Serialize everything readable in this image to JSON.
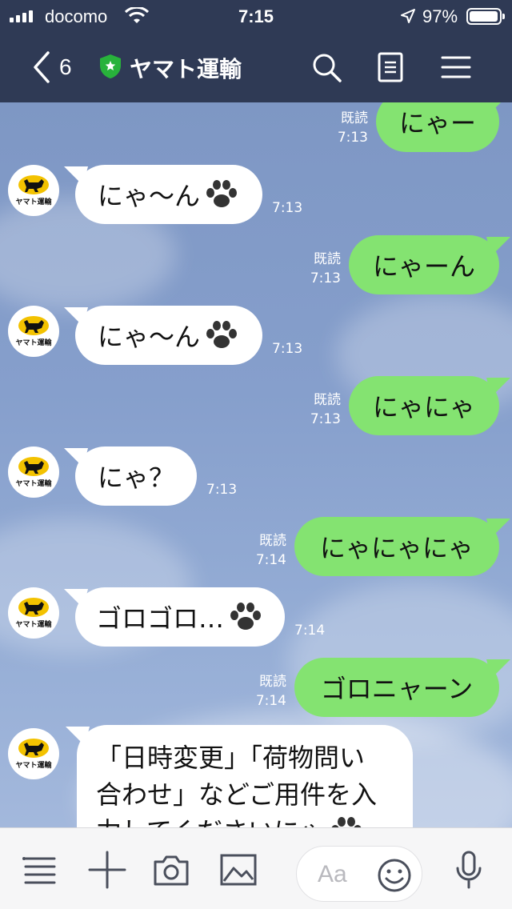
{
  "status_bar": {
    "carrier": "docomo",
    "time": "7:15",
    "battery": "97%",
    "icons": [
      "signal-icon",
      "wifi-icon",
      "location-arrow-icon",
      "battery-icon"
    ]
  },
  "header": {
    "back_count": "6",
    "title": "ヤマト運輸",
    "icons": [
      "back-chevron-icon",
      "verified-shield-icon",
      "search-icon",
      "notes-icon",
      "menu-icon"
    ]
  },
  "account": {
    "logo_text": "ヤマト運輸"
  },
  "messages": [
    {
      "dir": "out",
      "text": "にゃー",
      "read": "既読",
      "time": "7:13"
    },
    {
      "dir": "in",
      "text": "にゃ〜ん",
      "paw": true,
      "time": "7:13"
    },
    {
      "dir": "out",
      "text": "にゃーん",
      "read": "既読",
      "time": "7:13"
    },
    {
      "dir": "in",
      "text": "にゃ〜ん",
      "paw": true,
      "time": "7:13"
    },
    {
      "dir": "out",
      "text": "にゃにゃ",
      "read": "既読",
      "time": "7:13"
    },
    {
      "dir": "in",
      "text": "にゃ？",
      "paw": false,
      "time": "7:13"
    },
    {
      "dir": "out",
      "text": "にゃにゃにゃ",
      "read": "既読",
      "time": "7:14"
    },
    {
      "dir": "in",
      "text": "ゴロゴロ…",
      "paw": true,
      "time": "7:14"
    },
    {
      "dir": "out",
      "text": "ゴロニャーン",
      "read": "既読",
      "time": "7:14"
    },
    {
      "dir": "in",
      "lines": [
        "「日時変更」「荷物問い",
        "合わせ」などご用件を入",
        "力してくださいにゃ"
      ],
      "paw": true
    }
  ],
  "input_bar": {
    "placeholder": "Aa",
    "icons": [
      "menu-list-icon",
      "plus-icon",
      "camera-icon",
      "image-icon",
      "emoji-icon",
      "microphone-icon"
    ]
  },
  "colors": {
    "header": "#2f3a55",
    "out_bubble": "#84e371",
    "in_bubble": "#ffffff"
  }
}
